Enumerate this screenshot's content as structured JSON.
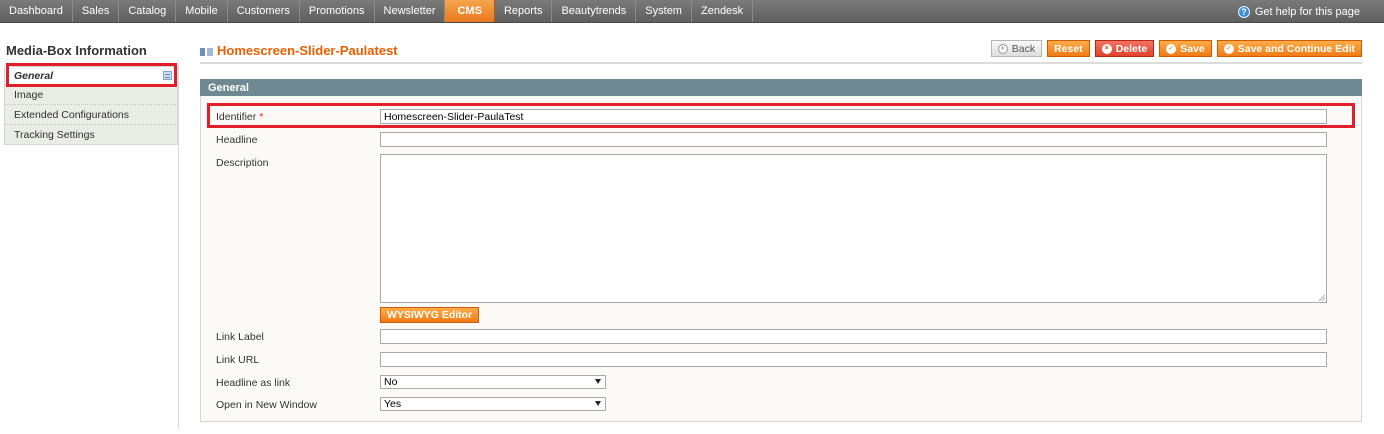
{
  "nav": {
    "items": [
      {
        "label": "Dashboard"
      },
      {
        "label": "Sales"
      },
      {
        "label": "Catalog"
      },
      {
        "label": "Mobile"
      },
      {
        "label": "Customers"
      },
      {
        "label": "Promotions"
      },
      {
        "label": "Newsletter"
      },
      {
        "label": "CMS",
        "active": true
      },
      {
        "label": "Reports"
      },
      {
        "label": "Beautytrends"
      },
      {
        "label": "System"
      },
      {
        "label": "Zendesk"
      }
    ],
    "help_label": "Get help for this page",
    "help_icon": "?"
  },
  "sidebar": {
    "title": "Media-Box Information",
    "tabs": [
      {
        "label": "General",
        "active": true
      },
      {
        "label": "Image"
      },
      {
        "label": "Extended Configurations"
      },
      {
        "label": "Tracking Settings"
      }
    ]
  },
  "page": {
    "title": "Homescreen-Slider-Paulatest",
    "buttons": {
      "back": "Back",
      "reset": "Reset",
      "delete": "Delete",
      "save": "Save",
      "save_continue": "Save and Continue Edit"
    }
  },
  "form": {
    "section_title": "General",
    "identifier": {
      "label": "Identifier",
      "required_mark": "*",
      "value": "Homescreen-Slider-PaulaTest"
    },
    "headline": {
      "label": "Headline",
      "value": ""
    },
    "description": {
      "label": "Description",
      "value": ""
    },
    "wysiwyg_label": "WYSIWYG Editor",
    "link_label": {
      "label": "Link Label",
      "value": ""
    },
    "link_url": {
      "label": "Link URL",
      "value": ""
    },
    "headline_as_link": {
      "label": "Headline as link",
      "value": "No"
    },
    "open_new_window": {
      "label": "Open in New Window",
      "value": "Yes"
    }
  },
  "colors": {
    "accent": "#eb5e00",
    "highlight": "#e11e2a",
    "section_header": "#6f8992"
  }
}
